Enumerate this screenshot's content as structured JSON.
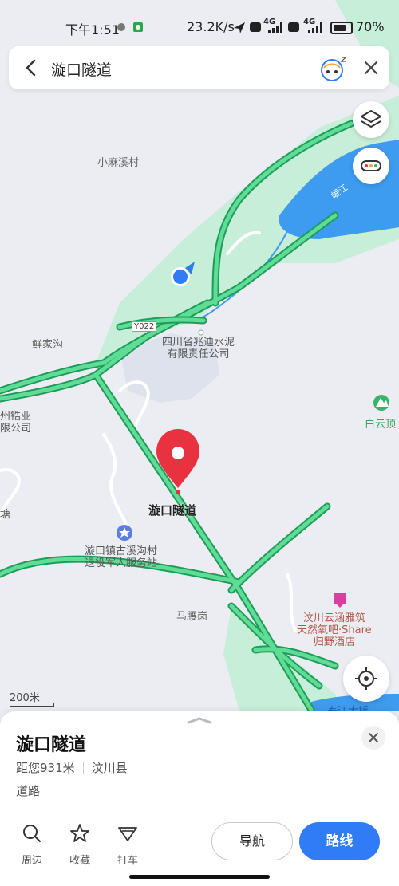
{
  "status_bar": {
    "time": "下午1:51",
    "network_speed": "23.2K/s",
    "sim1_label": "4G",
    "sim2_label": "4G",
    "battery": "70%"
  },
  "search": {
    "query": "漩口隧道"
  },
  "map": {
    "labels": {
      "village_xiaomaxi": "小麻溪村",
      "xianjiagou": "鲜家沟",
      "road_code": "Y022",
      "cement_company": "四川省兆迪水泥\n有限责任公司",
      "zhou_company_fragment": "州锆业\n限公司",
      "baiyunding": "白云顶",
      "tang_fragment": "塘",
      "pin_label": "漩口隧道",
      "veterans_station": "漩口镇古溪沟村\n退役军人服务站",
      "majiagang": "马腰岗",
      "hotel": "汶川云涵雅筑\n天然氧吧·Share\n归野酒店",
      "river": "岷江",
      "bridge_fragment": "寿江大桥"
    },
    "scale_label": "200米",
    "colors": {
      "road_green": "#3cc97c",
      "pin_red": "#e8323f",
      "water": "#3d9bf0",
      "location_blue": "#2f7cf6"
    }
  },
  "place": {
    "title": "漩口隧道",
    "distance": "距您931米",
    "county": "汶川县",
    "category": "道路"
  },
  "actions": [
    {
      "label": "周边",
      "icon": "search-icon"
    },
    {
      "label": "收藏",
      "icon": "star-icon"
    },
    {
      "label": "打车",
      "icon": "taxi-icon"
    }
  ],
  "buttons": {
    "navigate": "导航",
    "route": "路线"
  }
}
